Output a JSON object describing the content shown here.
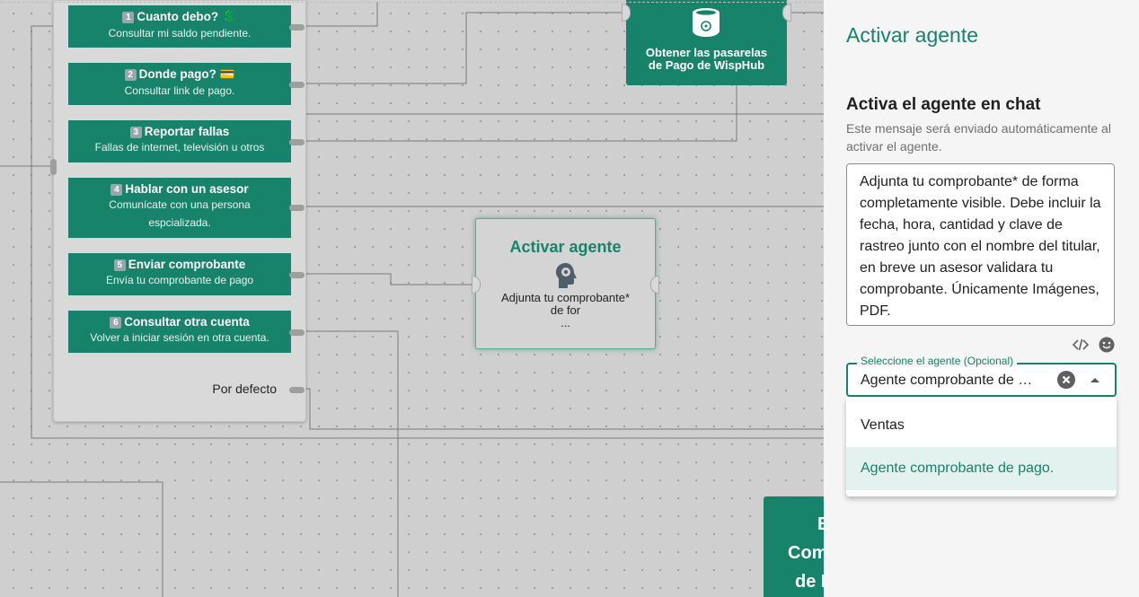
{
  "menu": {
    "options": [
      {
        "num": "1",
        "title": "Cuanto debo? 💲",
        "subtitle": "Consultar mi saldo pendiente."
      },
      {
        "num": "2",
        "title": "Donde pago? 💳",
        "subtitle": "Consultar link de pago."
      },
      {
        "num": "3",
        "title": "Reportar fallas",
        "subtitle": "Fallas de internet, televisión u otros"
      },
      {
        "num": "4",
        "title": "Hablar con un asesor",
        "subtitle": "Comunícate con una persona espcializada."
      },
      {
        "num": "5",
        "title": "Enviar comprobante",
        "subtitle": "Envía tu comprobante de pago"
      },
      {
        "num": "6",
        "title": "Consultar otra cuenta",
        "subtitle": "Volver a iniciar sesión en otra cuenta."
      }
    ],
    "default_label": "Por defecto"
  },
  "agent_node": {
    "title": "Activar agente",
    "desc_line1": "Adjunta tu comprobante*",
    "desc_line2": "de for",
    "desc_more": "..."
  },
  "pay_node": {
    "title_line1": "Obtener las pasarelas",
    "title_line2": "de Pago de WispHub"
  },
  "bottom_node": {
    "line1": "E",
    "line2": "Com",
    "line3": "de I"
  },
  "panel": {
    "title": "Activar agente",
    "section_title": "Activa el agente en chat",
    "section_help": "Este mensaje será enviado automáticamente al activar el agente.",
    "message": "Adjunta tu comprobante* de forma completamente visible. Debe incluir la fecha, hora, cantidad y clave de rastreo junto con el nombre del titular, en breve un asesor validara tu comprobante. Únicamente Imágenes, PDF.",
    "code_icon": "code-icon",
    "emoji_icon": "emoji-icon",
    "select_label": "Seleccione el agente (Opcional)",
    "select_value": "Agente comprobante de pago.",
    "options": [
      {
        "label": "Ventas",
        "selected": false
      },
      {
        "label": "Agente comprobante de pago.",
        "selected": true
      }
    ]
  },
  "colors": {
    "primary": "#16836a",
    "selected_bg": "#e3f2ee",
    "canvas": "#cfcfcf"
  }
}
